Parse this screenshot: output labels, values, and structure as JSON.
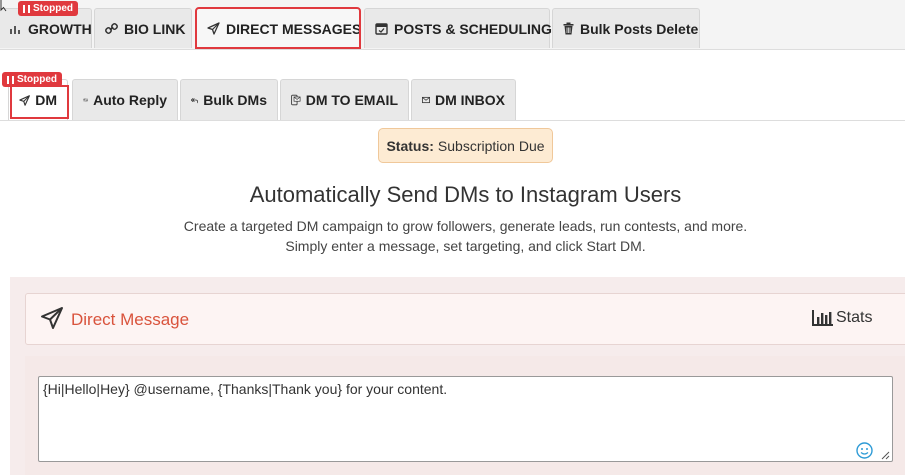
{
  "top_tabs": [
    {
      "label": "GROWTH",
      "icon": "bar-chart-icon"
    },
    {
      "label": "BIO LINK",
      "icon": "link-icon"
    },
    {
      "label": "DIRECT MESSAGES",
      "icon": "paper-plane-icon"
    },
    {
      "label": "POSTS & SCHEDULING",
      "icon": "calendar-icon"
    },
    {
      "label": "Bulk Posts Delete",
      "icon": "trash-icon"
    }
  ],
  "top_badge": "Stopped",
  "sub_badge": "Stopped",
  "sub_tabs": [
    {
      "label": "DM",
      "icon": "paper-plane-icon"
    },
    {
      "label": "Auto Reply",
      "icon": "retweet-icon"
    },
    {
      "label": "Bulk DMs",
      "icon": "reply-all-icon"
    },
    {
      "label": "DM TO EMAIL",
      "icon": "phone-email-icon"
    },
    {
      "label": "DM INBOX",
      "icon": "envelope-icon"
    }
  ],
  "status": {
    "label": "Status:",
    "value": "Subscription Due"
  },
  "headline": "Automatically Send DMs to Instagram Users",
  "description": [
    "Create a targeted DM campaign to grow followers, generate leads, run contests, and more.",
    "Simply enter a message, set targeting, and click Start DM."
  ],
  "panel": {
    "title": "Direct Message",
    "stats_label": "Stats"
  },
  "message": {
    "value": "{Hi|Hello|Hey} @username, {Thanks|Thank you} for your content."
  },
  "colors": {
    "accent": "#e0393e",
    "panel_title": "#d9533c",
    "status_bg": "#fdebd3"
  }
}
